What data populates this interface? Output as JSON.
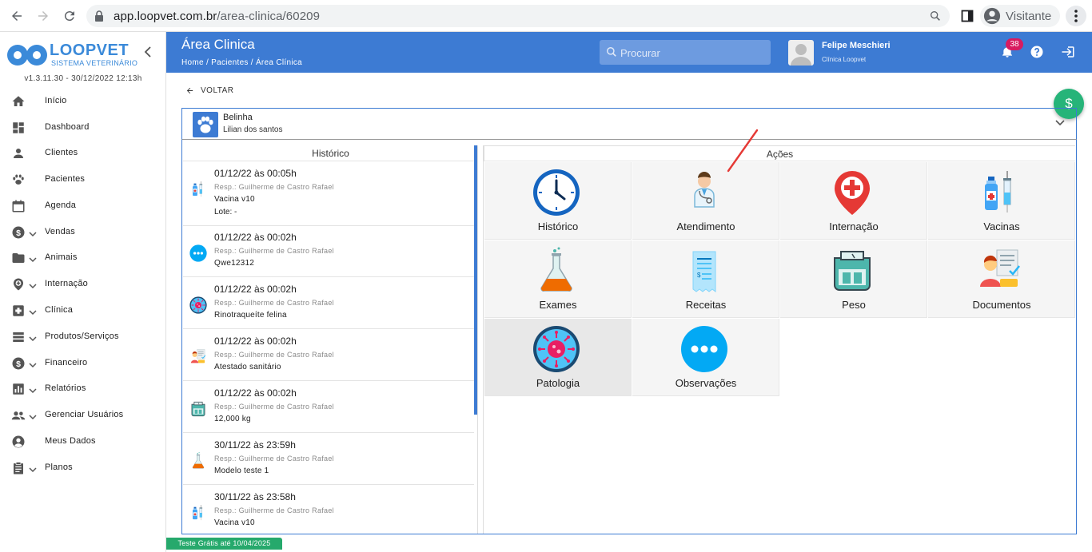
{
  "browser": {
    "url_host": "app.loopvet.com.br",
    "url_path": "/area-clinica/60209",
    "profile_label": "Visitante"
  },
  "sidebar": {
    "logo_title": "LOOPVET",
    "logo_subtitle": "SISTEMA VETERINÁRIO",
    "version": "v1.3.11.30 - 30/12/2022 12:13h",
    "items": [
      {
        "label": "Início",
        "icon": "home-icon",
        "expandable": false
      },
      {
        "label": "Dashboard",
        "icon": "dashboard-icon",
        "expandable": false
      },
      {
        "label": "Clientes",
        "icon": "person-icon",
        "expandable": false
      },
      {
        "label": "Pacientes",
        "icon": "paw-icon",
        "expandable": false
      },
      {
        "label": "Agenda",
        "icon": "calendar-icon",
        "expandable": false
      },
      {
        "label": "Vendas",
        "icon": "dollar-icon",
        "expandable": true
      },
      {
        "label": "Animais",
        "icon": "folder-icon",
        "expandable": true
      },
      {
        "label": "Internação",
        "icon": "hospital-pin-icon",
        "expandable": true
      },
      {
        "label": "Clínica",
        "icon": "clinic-icon",
        "expandable": true
      },
      {
        "label": "Produtos/Serviços",
        "icon": "list-icon",
        "expandable": true
      },
      {
        "label": "Financeiro",
        "icon": "dollar-icon",
        "expandable": true
      },
      {
        "label": "Relatórios",
        "icon": "chart-icon",
        "expandable": true
      },
      {
        "label": "Gerenciar Usuários",
        "icon": "group-icon",
        "expandable": true
      },
      {
        "label": "Meus Dados",
        "icon": "account-circle-icon",
        "expandable": false
      },
      {
        "label": "Planos",
        "icon": "clipboard-icon",
        "expandable": true
      }
    ]
  },
  "header": {
    "title": "Área Clinica",
    "breadcrumb": "Home  /  Pacientes  /  Área Clínica",
    "search_placeholder": "Procurar",
    "user_name": "Felipe Meschieri",
    "user_clinic": "Clínica Loopvet",
    "notification_count": "38",
    "accent_color": "#3d7bd3"
  },
  "back_label": "VOLTAR",
  "fab_label": "$",
  "patient": {
    "name": "Belinha",
    "owner": "Lilian dos santos"
  },
  "historico": {
    "title": "Histórico",
    "entries": [
      {
        "date": "01/12/22 às 00:05h",
        "resp": "Resp.: Guilherme de Castro Rafael",
        "desc": "Vacina v10",
        "extra": "Lote: -",
        "icon": "vaccine-icon"
      },
      {
        "date": "01/12/22 às 00:02h",
        "resp": "Resp.: Guilherme de Castro Rafael",
        "desc": "Qwe12312",
        "extra": "",
        "icon": "more-icon"
      },
      {
        "date": "01/12/22 às 00:02h",
        "resp": "Resp.: Guilherme de Castro Rafael",
        "desc": "Rinotraqueíte felina",
        "extra": "",
        "icon": "virus-icon"
      },
      {
        "date": "01/12/22 às 00:02h",
        "resp": "Resp.: Guilherme de Castro Rafael",
        "desc": "Atestado sanitário",
        "extra": "",
        "icon": "document-icon"
      },
      {
        "date": "01/12/22 às 00:02h",
        "resp": "Resp.: Guilherme de Castro Rafael",
        "desc": "12,000 kg",
        "extra": "",
        "icon": "scale-icon"
      },
      {
        "date": "30/11/22 às 23:59h",
        "resp": "Resp.: Guilherme de Castro Rafael",
        "desc": "Modelo teste 1",
        "extra": "",
        "icon": "flask-icon"
      },
      {
        "date": "30/11/22 às 23:58h",
        "resp": "Resp.: Guilherme de Castro Rafael",
        "desc": "Vacina v10",
        "extra": "",
        "icon": "vaccine-icon"
      }
    ]
  },
  "acoes": {
    "title": "Ações",
    "tiles": [
      {
        "label": "Histórico",
        "icon": "clock-icon"
      },
      {
        "label": "Atendimento",
        "icon": "doctor-icon"
      },
      {
        "label": "Internação",
        "icon": "hospital-pin-icon"
      },
      {
        "label": "Vacinas",
        "icon": "vaccine-icon"
      },
      {
        "label": "Exames",
        "icon": "flask-icon"
      },
      {
        "label": "Receitas",
        "icon": "receipt-icon"
      },
      {
        "label": "Peso",
        "icon": "scale-icon"
      },
      {
        "label": "Documentos",
        "icon": "document-icon"
      },
      {
        "label": "Patologia",
        "icon": "virus-icon"
      },
      {
        "label": "Observações",
        "icon": "more-icon"
      }
    ]
  },
  "trial_label": "Teste Grátis até 10/04/2025"
}
